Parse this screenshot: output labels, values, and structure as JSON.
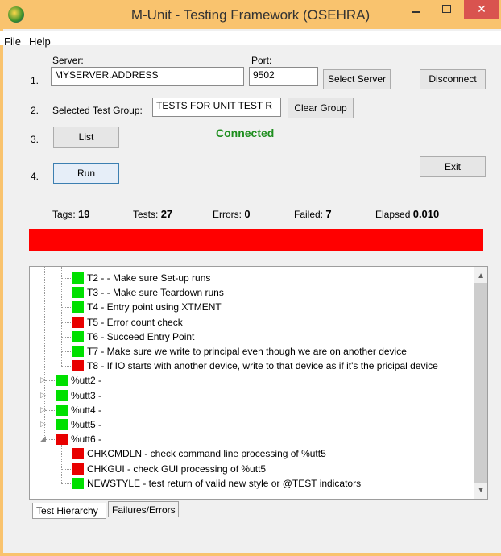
{
  "window": {
    "title": "M-Unit - Testing Framework (OSEHRA)",
    "close_glyph": "✕"
  },
  "menu": {
    "file": "File",
    "help": "Help"
  },
  "form": {
    "server_label": "Server:",
    "port_label": "Port:",
    "step1": "1.",
    "server_value": "MYSERVER.ADDRESS",
    "port_value": "9502",
    "select_server": "Select Server",
    "disconnect": "Disconnect",
    "step2": "2.",
    "selected_group_label": "Selected Test Group:",
    "selected_group_value": "TESTS FOR UNIT TEST R",
    "clear_group": "Clear Group",
    "step3": "3.",
    "list": "List",
    "status": "Connected",
    "step4": "4.",
    "run": "Run",
    "exit": "Exit"
  },
  "stats": {
    "tags_label": "Tags:",
    "tags_value": "19",
    "tests_label": "Tests:",
    "tests_value": "27",
    "errors_label": "Errors:",
    "errors_value": "0",
    "failed_label": "Failed:",
    "failed_value": "7",
    "elapsed_label": "Elapsed",
    "elapsed_value": "0.010"
  },
  "progress": {
    "color": "#ff0000"
  },
  "tree": {
    "items": [
      {
        "text": "T2 - - Make sure Set-up runs",
        "status": "pass"
      },
      {
        "text": "T3 - - Make sure Teardown runs",
        "status": "pass"
      },
      {
        "text": "T4 - Entry point using XTMENT",
        "status": "pass"
      },
      {
        "text": "T5 - Error count check",
        "status": "fail"
      },
      {
        "text": "T6 - Succeed Entry Point",
        "status": "pass"
      },
      {
        "text": "T7 - Make sure we write to principal even though we are on another device",
        "status": "pass"
      },
      {
        "text": "T8 - If IO starts with another device, write to that device as if it's the pricipal device",
        "status": "fail"
      },
      {
        "text": "%utt2 -",
        "status": "pass"
      },
      {
        "text": "%utt3 -",
        "status": "pass"
      },
      {
        "text": "%utt4 -",
        "status": "pass"
      },
      {
        "text": "%utt5 -",
        "status": "pass"
      },
      {
        "text": "%utt6 -",
        "status": "fail"
      },
      {
        "text": "CHKCMDLN - check command line processing of %utt5",
        "status": "fail"
      },
      {
        "text": "CHKGUI - check GUI processing of %utt5",
        "status": "fail"
      },
      {
        "text": "NEWSTYLE - test return of valid new style or @TEST indicators",
        "status": "pass"
      }
    ]
  },
  "tabs": {
    "hierarchy": "Test Hierarchy",
    "failures": "Failures/Errors"
  },
  "colors": {
    "pass": "#00e000",
    "fail": "#e80000",
    "titlebar": "#f9c36e",
    "connected": "#1e8e1e"
  }
}
